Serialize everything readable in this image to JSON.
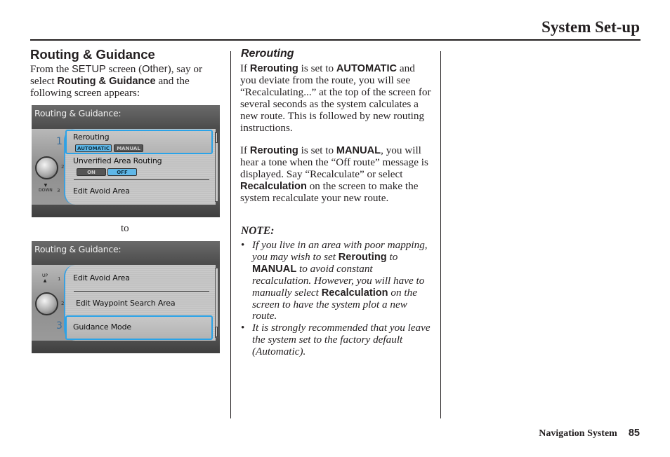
{
  "header": {
    "title": "System Set-up"
  },
  "left": {
    "section_title": "Routing & Guidance",
    "intro": {
      "t1": "From the ",
      "setup": "SETUP",
      "t2": " screen (",
      "other": "Other",
      "t3": "), say or select ",
      "bold": "Routing & Guidance",
      "t4": " and the following screen appears:"
    },
    "to_label": "to",
    "screen1": {
      "title": "Routing & Guidance:",
      "numbers": [
        "1",
        "2",
        "3"
      ],
      "down_label": "DOWN",
      "items": [
        {
          "label": "Rerouting",
          "options": [
            "AUTOMATIC",
            "MANUAL"
          ],
          "selected_option": "AUTOMATIC"
        },
        {
          "label": "Unverified Area Routing",
          "options": [
            "ON",
            "OFF"
          ],
          "selected_option": "OFF"
        },
        {
          "label": "Edit Avoid Area"
        }
      ],
      "selected_item": 1
    },
    "screen2": {
      "title": "Routing & Guidance:",
      "numbers": [
        "1",
        "2",
        "3"
      ],
      "up_label": "UP",
      "items": [
        {
          "label": "Edit Avoid Area"
        },
        {
          "label": "Edit Waypoint Search Area"
        },
        {
          "label": "Guidance Mode"
        }
      ],
      "selected_item": 3
    }
  },
  "right": {
    "subtitle": "Rerouting",
    "p1": {
      "t1": "If ",
      "b1": "Rerouting",
      "t2": " is set to ",
      "b2": "AUTOMATIC",
      "t3": " and you deviate from the route, you will see “Recalculating...” at the top of the screen for several seconds as the system calculates a new route. This is followed by new routing instructions."
    },
    "p2": {
      "t1": "If ",
      "b1": "Rerouting",
      "t2": " is set to ",
      "b2": "MANUAL",
      "t3": ", you will hear a tone when the “Off route” message is displayed. Say “Recalculate” or select ",
      "b3": "Recalculation",
      "t4": " on the screen to make the system recalculate your new route."
    },
    "note_title": "NOTE:",
    "bullets": [
      {
        "t1": "If you live in an area with poor mapping, you may wish to set ",
        "b1": "Rerouting",
        "t2": " to ",
        "b2": "MANUAL",
        "t3": " to avoid constant recalculation. However, you will have to manually select ",
        "b3": "Recalculation",
        "t4": " on the screen to have the system plot a new route."
      },
      {
        "t1": "It is strongly recommended that you leave the system set to the factory default (Automatic)."
      }
    ]
  },
  "footer": {
    "section": "Navigation System",
    "page": "85"
  }
}
